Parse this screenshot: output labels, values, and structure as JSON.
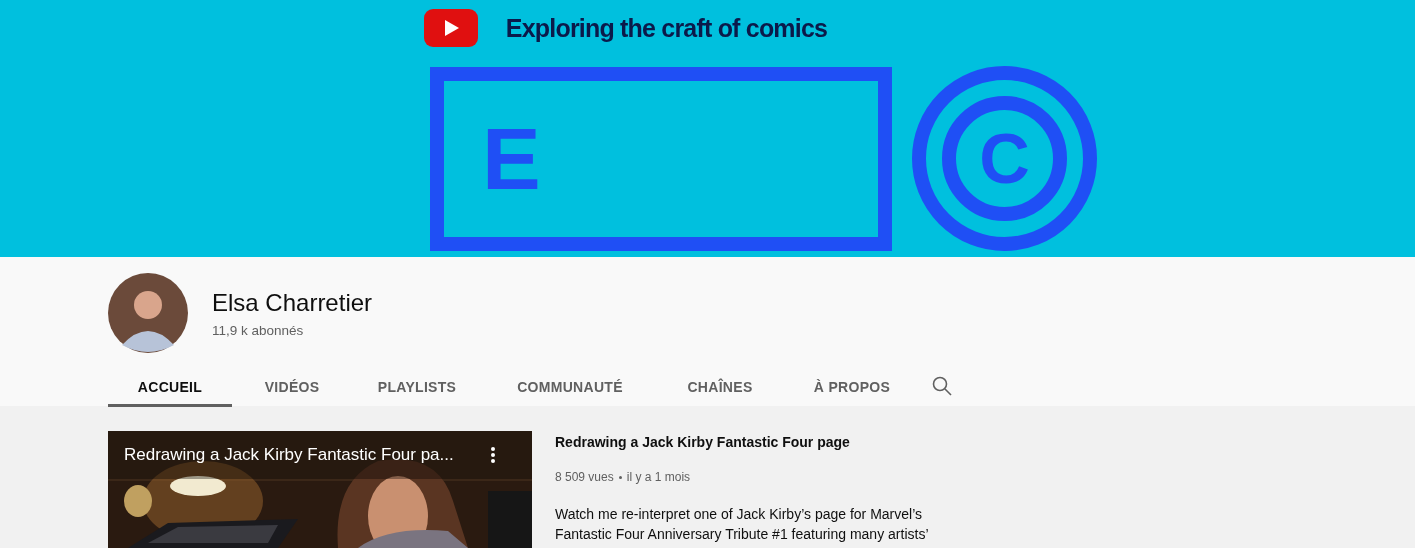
{
  "banner": {
    "tagline": "Exploring the craft of comics",
    "letters": [
      "E",
      "C"
    ]
  },
  "channel": {
    "name": "Elsa Charretier",
    "subscribers": "11,9 k abonnés"
  },
  "tabs": [
    {
      "label": "ACCUEIL",
      "selected": true
    },
    {
      "label": "VIDÉOS",
      "selected": false
    },
    {
      "label": "PLAYLISTS",
      "selected": false
    },
    {
      "label": "COMMUNAUTÉ",
      "selected": false
    },
    {
      "label": "CHAÎNES",
      "selected": false
    },
    {
      "label": "À PROPOS",
      "selected": false
    }
  ],
  "featured_video": {
    "thumbnail": {
      "kind": "picture",
      "overlay_title": "Redrawing a Jack Kirby Fantastic Four pa..."
    },
    "title": "Redrawing a Jack Kirby Fantastic Four page",
    "views": "8 509 vues",
    "age": "il y a 1 mois",
    "description": [
      "Watch me re-interpret one of Jack Kirby’s page for Marvel’s",
      "Fantastic Four Anniversary Tribute #1 featuring many artists’"
    ]
  }
}
